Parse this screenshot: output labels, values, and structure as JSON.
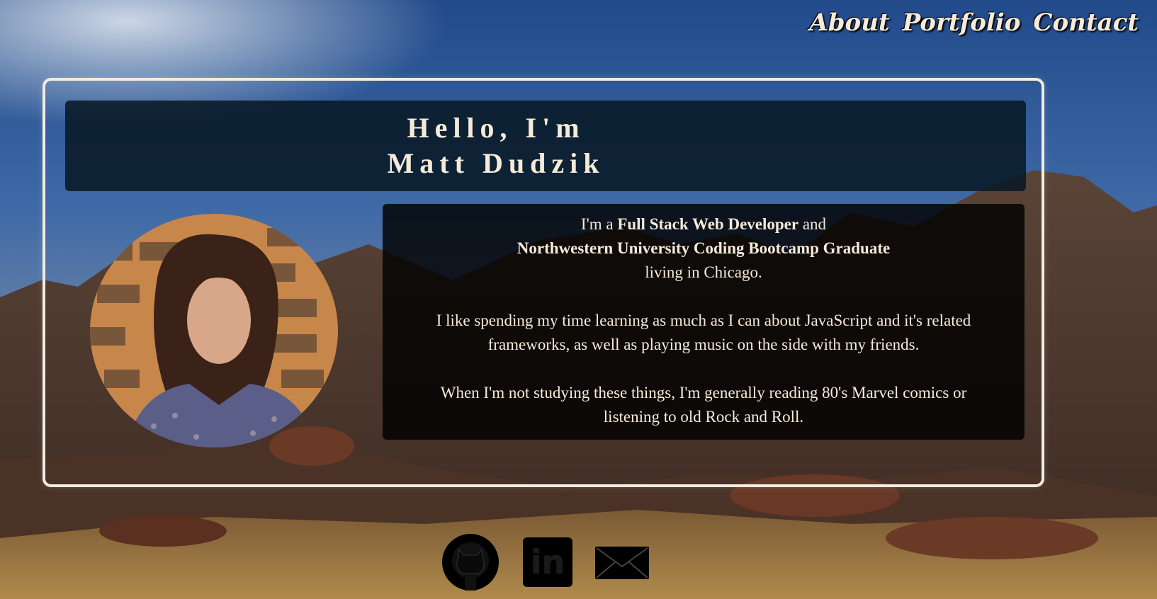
{
  "nav": {
    "items": [
      "About",
      "Portfolio",
      "Contact"
    ]
  },
  "hero": {
    "greeting": "Hello, I'm",
    "name": "Matt Dudzik"
  },
  "bio": {
    "p1_pre": "I'm a",
    "p1_role": "Full Stack Web Developer",
    "p1_and": "and",
    "p1_school": "Northwestern University Coding Bootcamp Graduate",
    "p1_location": "living in Chicago.",
    "p2": "I like spending my time learning as much as I can about JavaScript and it's related frameworks, as well as playing music on the side with my friends.",
    "p3": "When I'm not studying these things, I'm generally reading 80's Marvel comics or listening to old Rock and Roll."
  },
  "social": {
    "icons": [
      "github-icon",
      "linkedin-icon",
      "email-icon"
    ],
    "linkedin_text": "in"
  },
  "colors": {
    "text": "#f6ead8",
    "border": "#f3ece2"
  }
}
